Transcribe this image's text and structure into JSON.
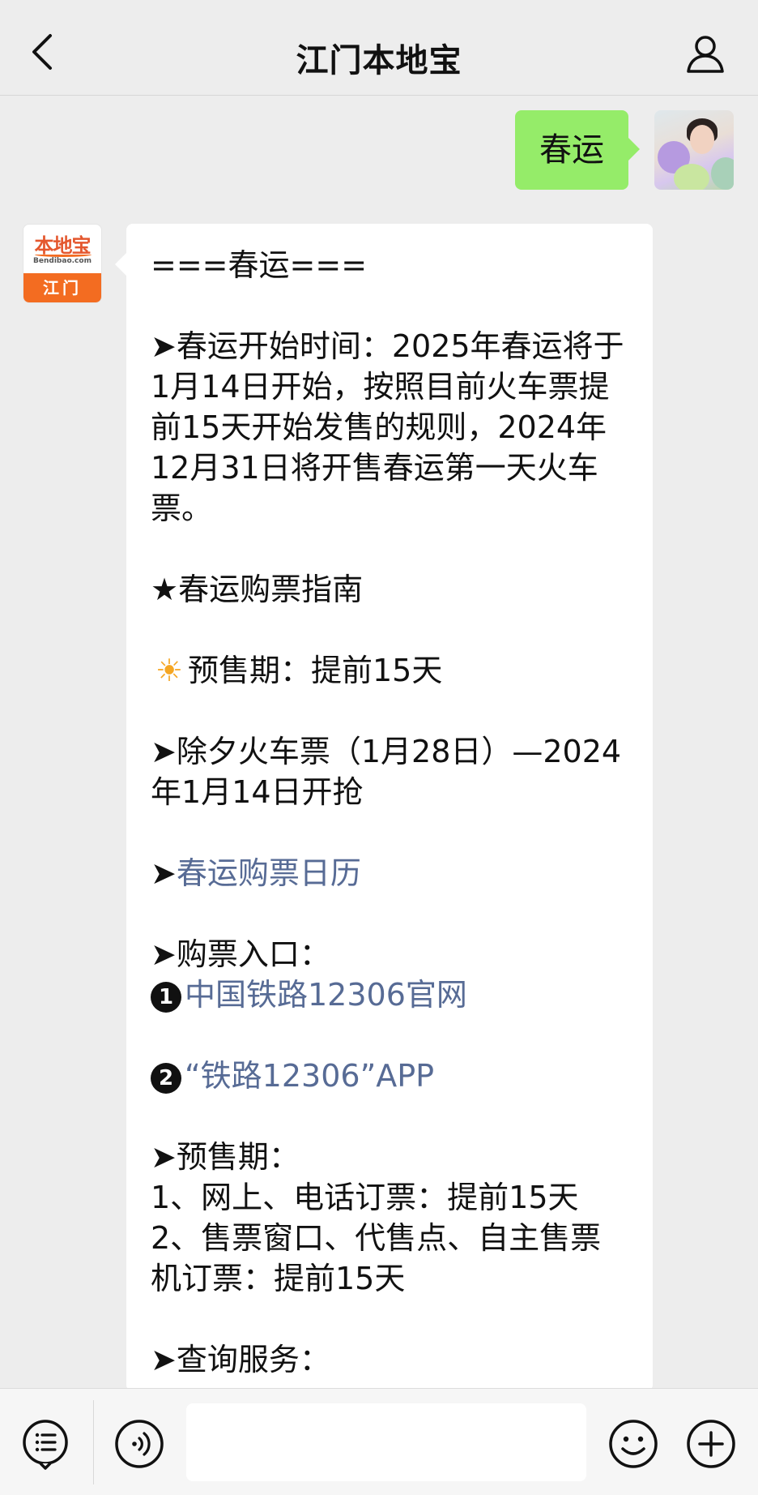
{
  "header": {
    "title": "江门本地宝"
  },
  "self_message": {
    "text": "春运"
  },
  "bot": {
    "logo_top": "本地宝",
    "logo_sub": "Bendibao.com",
    "logo_city": "江门"
  },
  "article": {
    "heading": "===春运===",
    "start_time": "➤春运开始时间：2025年春运将于1月14日开始，按照目前火车票提前15天开始发售的规则，2024年12月31日将开售春运第一天火车票。",
    "guide_title": "★春运购票指南",
    "presale_short": "预售期：提前15天",
    "new_year_eve": "➤除夕火车票（1月28日）—2024年1月14日开抢",
    "calendar_prefix": "➤",
    "calendar_link": "春运购票日历",
    "entry_title": "➤购票入口：",
    "entry_1_badge": "1",
    "entry_1_link": "中国铁路12306官网",
    "entry_2_badge": "2",
    "entry_2_link": "“铁路12306”APP",
    "presale_title": "➤预售期：",
    "presale_1": "1、网上、电话订票：提前15天",
    "presale_2": "2、售票窗口、代售点、自主售票机订票：提前15天",
    "query_title": "➤查询服务："
  },
  "icons": {
    "back": "chevron-left-icon",
    "profile": "person-icon",
    "sun": "sun-emoji-icon",
    "menu": "list-menu-icon",
    "voice": "voice-icon",
    "emoji": "smiley-icon",
    "plus": "plus-icon"
  },
  "colors": {
    "self_bubble": "#95ec69",
    "link": "#576b95",
    "brand_orange": "#f36c21"
  }
}
